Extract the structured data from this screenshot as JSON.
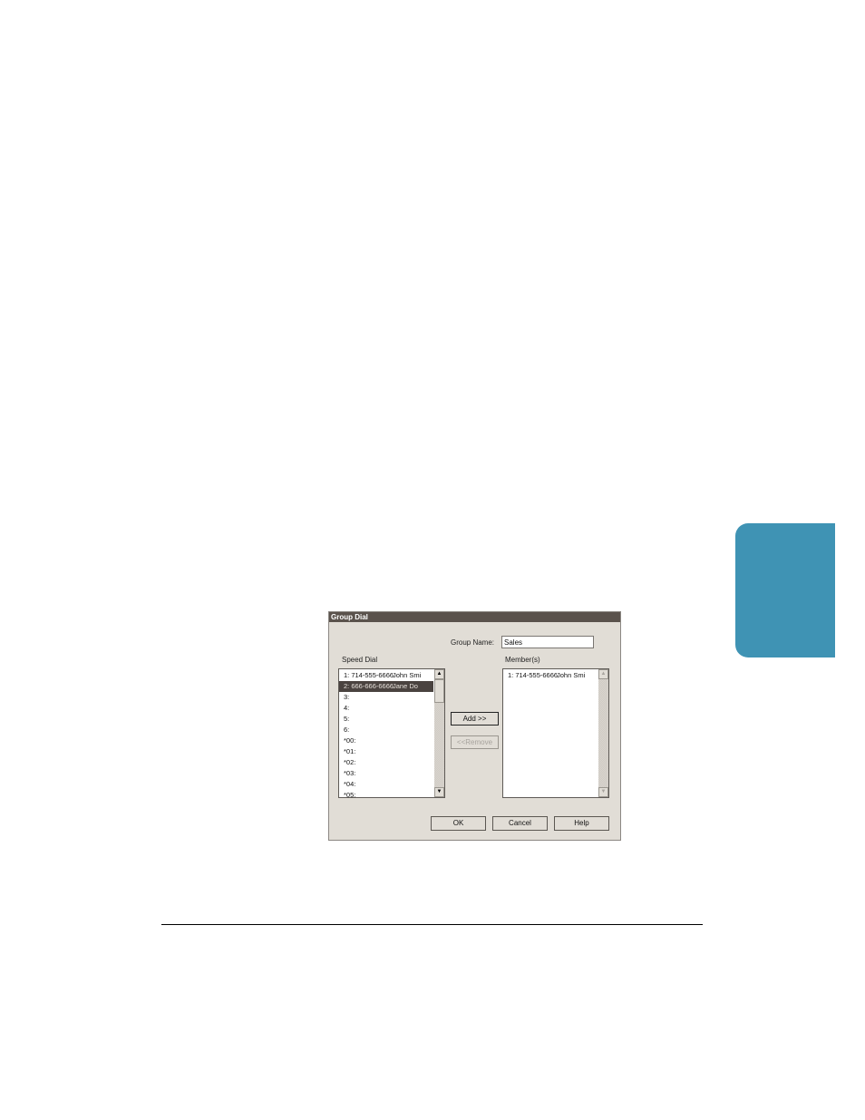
{
  "dialog": {
    "title": "Group Dial",
    "group_name_label": "Group Name:",
    "group_name_value": "Sales",
    "speed_dial_label": "Speed Dial",
    "members_label": "Member(s)",
    "add_label": "Add >>",
    "remove_label": "<<Remove",
    "ok_label": "OK",
    "cancel_label": "Cancel",
    "help_label": "Help"
  },
  "speed_dial": [
    {
      "num": "1:  714-555-6666",
      "name": "John Smi"
    },
    {
      "num": "2:  666-666-6666",
      "name": "Jane Do"
    },
    {
      "num": "3:",
      "name": ""
    },
    {
      "num": "4:",
      "name": ""
    },
    {
      "num": "5:",
      "name": ""
    },
    {
      "num": "6:",
      "name": ""
    },
    {
      "num": "*00:",
      "name": ""
    },
    {
      "num": "*01:",
      "name": ""
    },
    {
      "num": "*02:",
      "name": ""
    },
    {
      "num": "*03:",
      "name": ""
    },
    {
      "num": "*04:",
      "name": ""
    },
    {
      "num": "*05:",
      "name": ""
    }
  ],
  "members": [
    {
      "num": "1:  714-555-6666",
      "name": "John Smi"
    }
  ],
  "icons": {
    "up": "▲",
    "down": "▼"
  },
  "colors": {
    "side_tab": "#3f93b4",
    "title_bar": "#5a524c",
    "selected_row": "#4a4340"
  }
}
